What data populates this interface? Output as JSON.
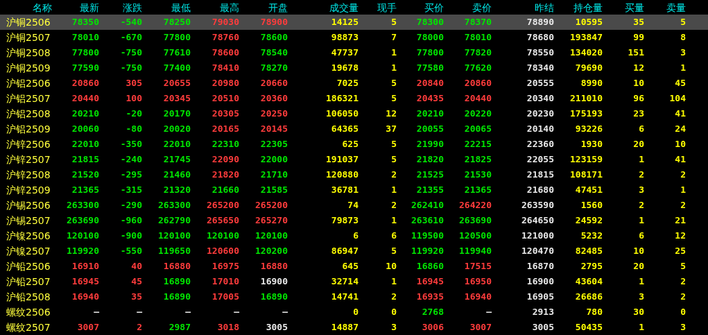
{
  "table": {
    "columns": [
      {
        "label": "名称",
        "kind": "name"
      },
      {
        "label": "最新",
        "kind": "price"
      },
      {
        "label": "涨跌",
        "kind": "price"
      },
      {
        "label": "最低",
        "kind": "price"
      },
      {
        "label": "最高",
        "kind": "price"
      },
      {
        "label": "开盘",
        "kind": "price"
      },
      {
        "label": "成交量",
        "kind": "volume"
      },
      {
        "label": "现手",
        "kind": "volume"
      },
      {
        "label": "买价",
        "kind": "price"
      },
      {
        "label": "卖价",
        "kind": "price"
      },
      {
        "label": "昨结",
        "kind": "settle"
      },
      {
        "label": "持仓量",
        "kind": "volume"
      },
      {
        "label": "买量",
        "kind": "volume"
      },
      {
        "label": "卖量",
        "kind": "volume"
      }
    ],
    "rows": [
      {
        "selected": true,
        "cells": [
          {
            "text": "沪铜2506"
          },
          {
            "text": "78350",
            "color": "#00e600"
          },
          {
            "text": "-540",
            "color": "#00e600"
          },
          {
            "text": "78250",
            "color": "#00e600"
          },
          {
            "text": "79030",
            "color": "#ff3c3c"
          },
          {
            "text": "78900",
            "color": "#ff3c3c"
          },
          {
            "text": "14125"
          },
          {
            "text": "5"
          },
          {
            "text": "78300",
            "color": "#00e600"
          },
          {
            "text": "78370",
            "color": "#00e600"
          },
          {
            "text": "78890"
          },
          {
            "text": "10595"
          },
          {
            "text": "35"
          },
          {
            "text": "5"
          }
        ]
      },
      {
        "selected": false,
        "cells": [
          {
            "text": "沪铜2507"
          },
          {
            "text": "78010",
            "color": "#00e600"
          },
          {
            "text": "-670",
            "color": "#00e600"
          },
          {
            "text": "77800",
            "color": "#00e600"
          },
          {
            "text": "78760",
            "color": "#ff3c3c"
          },
          {
            "text": "78600",
            "color": "#00e600"
          },
          {
            "text": "98873"
          },
          {
            "text": "7"
          },
          {
            "text": "78000",
            "color": "#00e600"
          },
          {
            "text": "78010",
            "color": "#00e600"
          },
          {
            "text": "78680"
          },
          {
            "text": "193847"
          },
          {
            "text": "99"
          },
          {
            "text": "8"
          }
        ]
      },
      {
        "selected": false,
        "cells": [
          {
            "text": "沪铜2508"
          },
          {
            "text": "77800",
            "color": "#00e600"
          },
          {
            "text": "-750",
            "color": "#00e600"
          },
          {
            "text": "77610",
            "color": "#00e600"
          },
          {
            "text": "78600",
            "color": "#ff3c3c"
          },
          {
            "text": "78540",
            "color": "#00e600"
          },
          {
            "text": "47737"
          },
          {
            "text": "1"
          },
          {
            "text": "77800",
            "color": "#00e600"
          },
          {
            "text": "77820",
            "color": "#00e600"
          },
          {
            "text": "78550"
          },
          {
            "text": "134020"
          },
          {
            "text": "151"
          },
          {
            "text": "3"
          }
        ]
      },
      {
        "selected": false,
        "cells": [
          {
            "text": "沪铜2509"
          },
          {
            "text": "77590",
            "color": "#00e600"
          },
          {
            "text": "-750",
            "color": "#00e600"
          },
          {
            "text": "77400",
            "color": "#00e600"
          },
          {
            "text": "78410",
            "color": "#ff3c3c"
          },
          {
            "text": "78270",
            "color": "#00e600"
          },
          {
            "text": "19678"
          },
          {
            "text": "1"
          },
          {
            "text": "77580",
            "color": "#00e600"
          },
          {
            "text": "77620",
            "color": "#00e600"
          },
          {
            "text": "78340"
          },
          {
            "text": "79690"
          },
          {
            "text": "12"
          },
          {
            "text": "1"
          }
        ]
      },
      {
        "selected": false,
        "cells": [
          {
            "text": "沪铝2506"
          },
          {
            "text": "20860",
            "color": "#ff3c3c"
          },
          {
            "text": "305",
            "color": "#ff3c3c"
          },
          {
            "text": "20655",
            "color": "#ff3c3c"
          },
          {
            "text": "20980",
            "color": "#ff3c3c"
          },
          {
            "text": "20660",
            "color": "#ff3c3c"
          },
          {
            "text": "7025"
          },
          {
            "text": "5"
          },
          {
            "text": "20840",
            "color": "#ff3c3c"
          },
          {
            "text": "20860",
            "color": "#ff3c3c"
          },
          {
            "text": "20555"
          },
          {
            "text": "8990"
          },
          {
            "text": "10"
          },
          {
            "text": "45"
          }
        ]
      },
      {
        "selected": false,
        "cells": [
          {
            "text": "沪铝2507"
          },
          {
            "text": "20440",
            "color": "#ff3c3c"
          },
          {
            "text": "100",
            "color": "#ff3c3c"
          },
          {
            "text": "20345",
            "color": "#ff3c3c"
          },
          {
            "text": "20510",
            "color": "#ff3c3c"
          },
          {
            "text": "20360",
            "color": "#ff3c3c"
          },
          {
            "text": "186321"
          },
          {
            "text": "5"
          },
          {
            "text": "20435",
            "color": "#ff3c3c"
          },
          {
            "text": "20440",
            "color": "#ff3c3c"
          },
          {
            "text": "20340"
          },
          {
            "text": "211010"
          },
          {
            "text": "96"
          },
          {
            "text": "104"
          }
        ]
      },
      {
        "selected": false,
        "cells": [
          {
            "text": "沪铝2508"
          },
          {
            "text": "20210",
            "color": "#00e600"
          },
          {
            "text": "-20",
            "color": "#00e600"
          },
          {
            "text": "20170",
            "color": "#00e600"
          },
          {
            "text": "20305",
            "color": "#ff3c3c"
          },
          {
            "text": "20250",
            "color": "#ff3c3c"
          },
          {
            "text": "106050"
          },
          {
            "text": "12"
          },
          {
            "text": "20210",
            "color": "#00e600"
          },
          {
            "text": "20220",
            "color": "#00e600"
          },
          {
            "text": "20230"
          },
          {
            "text": "175193"
          },
          {
            "text": "23"
          },
          {
            "text": "41"
          }
        ]
      },
      {
        "selected": false,
        "cells": [
          {
            "text": "沪铝2509"
          },
          {
            "text": "20060",
            "color": "#00e600"
          },
          {
            "text": "-80",
            "color": "#00e600"
          },
          {
            "text": "20020",
            "color": "#00e600"
          },
          {
            "text": "20165",
            "color": "#ff3c3c"
          },
          {
            "text": "20145",
            "color": "#ff3c3c"
          },
          {
            "text": "64365"
          },
          {
            "text": "37"
          },
          {
            "text": "20055",
            "color": "#00e600"
          },
          {
            "text": "20065",
            "color": "#00e600"
          },
          {
            "text": "20140"
          },
          {
            "text": "93226"
          },
          {
            "text": "6"
          },
          {
            "text": "24"
          }
        ]
      },
      {
        "selected": false,
        "cells": [
          {
            "text": "沪锌2506"
          },
          {
            "text": "22010",
            "color": "#00e600"
          },
          {
            "text": "-350",
            "color": "#00e600"
          },
          {
            "text": "22010",
            "color": "#00e600"
          },
          {
            "text": "22310",
            "color": "#00e600"
          },
          {
            "text": "22305",
            "color": "#00e600"
          },
          {
            "text": "625"
          },
          {
            "text": "5"
          },
          {
            "text": "21990",
            "color": "#00e600"
          },
          {
            "text": "22215",
            "color": "#00e600"
          },
          {
            "text": "22360"
          },
          {
            "text": "1930"
          },
          {
            "text": "20"
          },
          {
            "text": "10"
          }
        ]
      },
      {
        "selected": false,
        "cells": [
          {
            "text": "沪锌2507"
          },
          {
            "text": "21815",
            "color": "#00e600"
          },
          {
            "text": "-240",
            "color": "#00e600"
          },
          {
            "text": "21745",
            "color": "#00e600"
          },
          {
            "text": "22090",
            "color": "#ff3c3c"
          },
          {
            "text": "22000",
            "color": "#00e600"
          },
          {
            "text": "191037"
          },
          {
            "text": "5"
          },
          {
            "text": "21820",
            "color": "#00e600"
          },
          {
            "text": "21825",
            "color": "#00e600"
          },
          {
            "text": "22055"
          },
          {
            "text": "123159"
          },
          {
            "text": "1"
          },
          {
            "text": "41"
          }
        ]
      },
      {
        "selected": false,
        "cells": [
          {
            "text": "沪锌2508"
          },
          {
            "text": "21520",
            "color": "#00e600"
          },
          {
            "text": "-295",
            "color": "#00e600"
          },
          {
            "text": "21460",
            "color": "#00e600"
          },
          {
            "text": "21820",
            "color": "#ff3c3c"
          },
          {
            "text": "21710",
            "color": "#00e600"
          },
          {
            "text": "120880"
          },
          {
            "text": "2"
          },
          {
            "text": "21525",
            "color": "#00e600"
          },
          {
            "text": "21530",
            "color": "#00e600"
          },
          {
            "text": "21815"
          },
          {
            "text": "108171"
          },
          {
            "text": "2"
          },
          {
            "text": "2"
          }
        ]
      },
      {
        "selected": false,
        "cells": [
          {
            "text": "沪锌2509"
          },
          {
            "text": "21365",
            "color": "#00e600"
          },
          {
            "text": "-315",
            "color": "#00e600"
          },
          {
            "text": "21320",
            "color": "#00e600"
          },
          {
            "text": "21660",
            "color": "#00e600"
          },
          {
            "text": "21585",
            "color": "#00e600"
          },
          {
            "text": "36781"
          },
          {
            "text": "1"
          },
          {
            "text": "21355",
            "color": "#00e600"
          },
          {
            "text": "21365",
            "color": "#00e600"
          },
          {
            "text": "21680"
          },
          {
            "text": "47451"
          },
          {
            "text": "3"
          },
          {
            "text": "1"
          }
        ]
      },
      {
        "selected": false,
        "cells": [
          {
            "text": "沪锡2506"
          },
          {
            "text": "263300",
            "color": "#00e600"
          },
          {
            "text": "-290",
            "color": "#00e600"
          },
          {
            "text": "263300",
            "color": "#00e600"
          },
          {
            "text": "265200",
            "color": "#ff3c3c"
          },
          {
            "text": "265200",
            "color": "#ff3c3c"
          },
          {
            "text": "74"
          },
          {
            "text": "2"
          },
          {
            "text": "262410",
            "color": "#00e600"
          },
          {
            "text": "264220",
            "color": "#ff3c3c"
          },
          {
            "text": "263590"
          },
          {
            "text": "1560"
          },
          {
            "text": "2"
          },
          {
            "text": "2"
          }
        ]
      },
      {
        "selected": false,
        "cells": [
          {
            "text": "沪锡2507"
          },
          {
            "text": "263690",
            "color": "#00e600"
          },
          {
            "text": "-960",
            "color": "#00e600"
          },
          {
            "text": "262790",
            "color": "#00e600"
          },
          {
            "text": "265650",
            "color": "#ff3c3c"
          },
          {
            "text": "265270",
            "color": "#ff3c3c"
          },
          {
            "text": "79873"
          },
          {
            "text": "1"
          },
          {
            "text": "263610",
            "color": "#00e600"
          },
          {
            "text": "263690",
            "color": "#00e600"
          },
          {
            "text": "264650"
          },
          {
            "text": "24592"
          },
          {
            "text": "1"
          },
          {
            "text": "21"
          }
        ]
      },
      {
        "selected": false,
        "cells": [
          {
            "text": "沪镍2506"
          },
          {
            "text": "120100",
            "color": "#00e600"
          },
          {
            "text": "-900",
            "color": "#00e600"
          },
          {
            "text": "120100",
            "color": "#00e600"
          },
          {
            "text": "120100",
            "color": "#00e600"
          },
          {
            "text": "120100",
            "color": "#00e600"
          },
          {
            "text": "6"
          },
          {
            "text": "6"
          },
          {
            "text": "119500",
            "color": "#00e600"
          },
          {
            "text": "120500",
            "color": "#00e600"
          },
          {
            "text": "121000"
          },
          {
            "text": "5232"
          },
          {
            "text": "6"
          },
          {
            "text": "12"
          }
        ]
      },
      {
        "selected": false,
        "cells": [
          {
            "text": "沪镍2507"
          },
          {
            "text": "119920",
            "color": "#00e600"
          },
          {
            "text": "-550",
            "color": "#00e600"
          },
          {
            "text": "119650",
            "color": "#00e600"
          },
          {
            "text": "120600",
            "color": "#ff3c3c"
          },
          {
            "text": "120200",
            "color": "#00e600"
          },
          {
            "text": "86947"
          },
          {
            "text": "5"
          },
          {
            "text": "119920",
            "color": "#00e600"
          },
          {
            "text": "119940",
            "color": "#00e600"
          },
          {
            "text": "120470"
          },
          {
            "text": "82485"
          },
          {
            "text": "10"
          },
          {
            "text": "25"
          }
        ]
      },
      {
        "selected": false,
        "cells": [
          {
            "text": "沪铅2506"
          },
          {
            "text": "16910",
            "color": "#ff3c3c"
          },
          {
            "text": "40",
            "color": "#ff3c3c"
          },
          {
            "text": "16880",
            "color": "#ff3c3c"
          },
          {
            "text": "16975",
            "color": "#ff3c3c"
          },
          {
            "text": "16880",
            "color": "#ff3c3c"
          },
          {
            "text": "645"
          },
          {
            "text": "10"
          },
          {
            "text": "16860",
            "color": "#00e600"
          },
          {
            "text": "17515",
            "color": "#ff3c3c"
          },
          {
            "text": "16870"
          },
          {
            "text": "2795"
          },
          {
            "text": "20"
          },
          {
            "text": "5"
          }
        ]
      },
      {
        "selected": false,
        "cells": [
          {
            "text": "沪铅2507"
          },
          {
            "text": "16945",
            "color": "#ff3c3c"
          },
          {
            "text": "45",
            "color": "#ff3c3c"
          },
          {
            "text": "16890",
            "color": "#00e600"
          },
          {
            "text": "17010",
            "color": "#ff3c3c"
          },
          {
            "text": "16900",
            "color": "#e8e8e8"
          },
          {
            "text": "32714"
          },
          {
            "text": "1"
          },
          {
            "text": "16945",
            "color": "#ff3c3c"
          },
          {
            "text": "16950",
            "color": "#ff3c3c"
          },
          {
            "text": "16900"
          },
          {
            "text": "43604"
          },
          {
            "text": "1"
          },
          {
            "text": "2"
          }
        ]
      },
      {
        "selected": false,
        "cells": [
          {
            "text": "沪铅2508"
          },
          {
            "text": "16940",
            "color": "#ff3c3c"
          },
          {
            "text": "35",
            "color": "#ff3c3c"
          },
          {
            "text": "16890",
            "color": "#00e600"
          },
          {
            "text": "17005",
            "color": "#ff3c3c"
          },
          {
            "text": "16890",
            "color": "#00e600"
          },
          {
            "text": "14741"
          },
          {
            "text": "2"
          },
          {
            "text": "16935",
            "color": "#ff3c3c"
          },
          {
            "text": "16940",
            "color": "#ff3c3c"
          },
          {
            "text": "16905"
          },
          {
            "text": "26686"
          },
          {
            "text": "3"
          },
          {
            "text": "2"
          }
        ]
      },
      {
        "selected": false,
        "cells": [
          {
            "text": "螺纹2506"
          },
          {
            "text": "—",
            "color": "#e8e8e8"
          },
          {
            "text": "—",
            "color": "#e8e8e8"
          },
          {
            "text": "—",
            "color": "#e8e8e8"
          },
          {
            "text": "—",
            "color": "#e8e8e8"
          },
          {
            "text": "—",
            "color": "#e8e8e8"
          },
          {
            "text": "0"
          },
          {
            "text": "0"
          },
          {
            "text": "2768",
            "color": "#00e600"
          },
          {
            "text": "—",
            "color": "#e8e8e8"
          },
          {
            "text": "2913"
          },
          {
            "text": "780"
          },
          {
            "text": "30"
          },
          {
            "text": "0"
          }
        ]
      },
      {
        "selected": false,
        "cells": [
          {
            "text": "螺纹2507"
          },
          {
            "text": "3007",
            "color": "#ff3c3c"
          },
          {
            "text": "2",
            "color": "#ff3c3c"
          },
          {
            "text": "2987",
            "color": "#00e600"
          },
          {
            "text": "3018",
            "color": "#ff3c3c"
          },
          {
            "text": "3005",
            "color": "#e8e8e8"
          },
          {
            "text": "14887"
          },
          {
            "text": "3"
          },
          {
            "text": "3006",
            "color": "#ff3c3c"
          },
          {
            "text": "3007",
            "color": "#ff3c3c"
          },
          {
            "text": "3005"
          },
          {
            "text": "50435"
          },
          {
            "text": "1"
          },
          {
            "text": "3"
          }
        ]
      }
    ]
  }
}
